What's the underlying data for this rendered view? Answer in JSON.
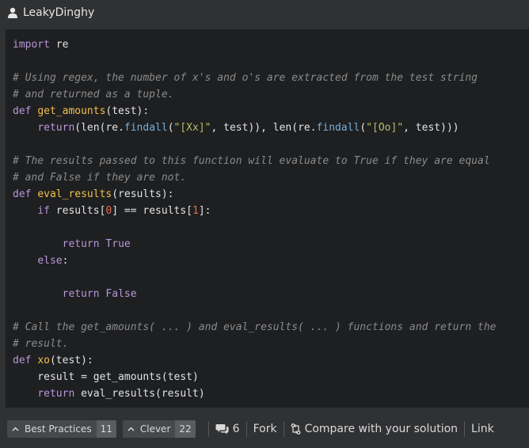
{
  "header": {
    "username": "LeakyDinghy",
    "user_icon": "user-icon"
  },
  "code": {
    "language": "python",
    "lines": [
      [
        {
          "t": "import",
          "c": "kw"
        },
        {
          "t": " re",
          "c": ""
        }
      ],
      [],
      [
        {
          "t": "# Using regex, the number of x's and o's are extracted from the test string",
          "c": "cm"
        }
      ],
      [
        {
          "t": "# and returned as a tuple.",
          "c": "cm"
        }
      ],
      [
        {
          "t": "def",
          "c": "kw"
        },
        {
          "t": " ",
          "c": ""
        },
        {
          "t": "get_amounts",
          "c": "fn"
        },
        {
          "t": "(test):",
          "c": ""
        }
      ],
      [
        {
          "t": "    ",
          "c": ""
        },
        {
          "t": "return",
          "c": "kw"
        },
        {
          "t": "(len(re.",
          "c": ""
        },
        {
          "t": "findall",
          "c": "mt"
        },
        {
          "t": "(",
          "c": ""
        },
        {
          "t": "\"[Xx]\"",
          "c": "st"
        },
        {
          "t": ", test)), len(re.",
          "c": ""
        },
        {
          "t": "findall",
          "c": "mt"
        },
        {
          "t": "(",
          "c": ""
        },
        {
          "t": "\"[Oo]\"",
          "c": "st"
        },
        {
          "t": ", test)))",
          "c": ""
        }
      ],
      [],
      [
        {
          "t": "# The results passed to this function will evaluate to True if they are equal",
          "c": "cm"
        }
      ],
      [
        {
          "t": "# and False if they are not.",
          "c": "cm"
        }
      ],
      [
        {
          "t": "def",
          "c": "kw"
        },
        {
          "t": " ",
          "c": ""
        },
        {
          "t": "eval_results",
          "c": "fn"
        },
        {
          "t": "(results):",
          "c": ""
        }
      ],
      [
        {
          "t": "    ",
          "c": ""
        },
        {
          "t": "if",
          "c": "kw"
        },
        {
          "t": " results[",
          "c": ""
        },
        {
          "t": "0",
          "c": "nm"
        },
        {
          "t": "] == results[",
          "c": ""
        },
        {
          "t": "1",
          "c": "nm"
        },
        {
          "t": "]:",
          "c": ""
        }
      ],
      [],
      [
        {
          "t": "        ",
          "c": ""
        },
        {
          "t": "return",
          "c": "kw"
        },
        {
          "t": " ",
          "c": ""
        },
        {
          "t": "True",
          "c": "kw"
        }
      ],
      [
        {
          "t": "    ",
          "c": ""
        },
        {
          "t": "else",
          "c": "kw"
        },
        {
          "t": ":",
          "c": ""
        }
      ],
      [],
      [
        {
          "t": "        ",
          "c": ""
        },
        {
          "t": "return",
          "c": "kw"
        },
        {
          "t": " ",
          "c": ""
        },
        {
          "t": "False",
          "c": "kw"
        }
      ],
      [],
      [
        {
          "t": "# Call the get_amounts( ... ) and eval_results( ... ) functions and return the",
          "c": "cm"
        }
      ],
      [
        {
          "t": "# result.",
          "c": "cm"
        }
      ],
      [
        {
          "t": "def",
          "c": "kw"
        },
        {
          "t": " ",
          "c": ""
        },
        {
          "t": "xo",
          "c": "fn"
        },
        {
          "t": "(test):",
          "c": ""
        }
      ],
      [
        {
          "t": "    result = get_amounts(test)",
          "c": ""
        }
      ],
      [
        {
          "t": "    ",
          "c": ""
        },
        {
          "t": "return",
          "c": "kw"
        },
        {
          "t": " eval_results(result)",
          "c": ""
        }
      ]
    ]
  },
  "footer": {
    "best_practices_label": "Best Practices",
    "best_practices_count": "11",
    "clever_label": "Clever",
    "clever_count": "22",
    "comments_count": "6",
    "fork_label": "Fork",
    "compare_label": "Compare with your solution",
    "link_label": "Link"
  },
  "colors": {
    "page_bg": "#303133",
    "code_bg": "#1e1f21",
    "keyword": "#b996da",
    "comment": "#8b8b8b",
    "function": "#f0c04c",
    "method": "#77aed9",
    "string": "#b5bf6a",
    "number": "#e06c4d"
  }
}
